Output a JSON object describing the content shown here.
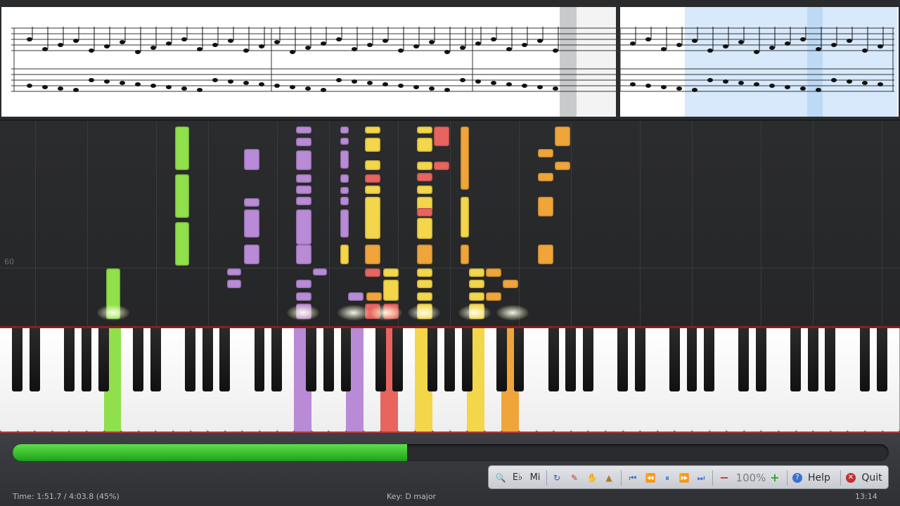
{
  "pitch_label": "60",
  "progress": {
    "fraction": 0.45
  },
  "status": {
    "time": "Time:  1:51.7 / 4:03.8 (45%)",
    "key": "Key: D major",
    "clock": "13:14"
  },
  "toolbar": {
    "eb_label": "E♭",
    "mi_label": "Mi",
    "zoom_value": "100%",
    "help_label": "Help",
    "quit_label": "Quit",
    "icons": [
      "magnifier-icon",
      "undo-icon",
      "pen-icon",
      "hand-icon",
      "metronome-icon",
      "skip-start-icon",
      "rewind-icon",
      "pause-icon",
      "fast-forward-icon",
      "skip-end-icon",
      "minus-icon",
      "plus-icon",
      "help-icon",
      "quit-icon"
    ]
  },
  "colors": {
    "green": "#8fe04a",
    "purple": "#b98ad6",
    "yellow": "#f3d64a",
    "orange": "#f0a53a",
    "red": "#e8645f",
    "progress": "#2fc028"
  }
}
